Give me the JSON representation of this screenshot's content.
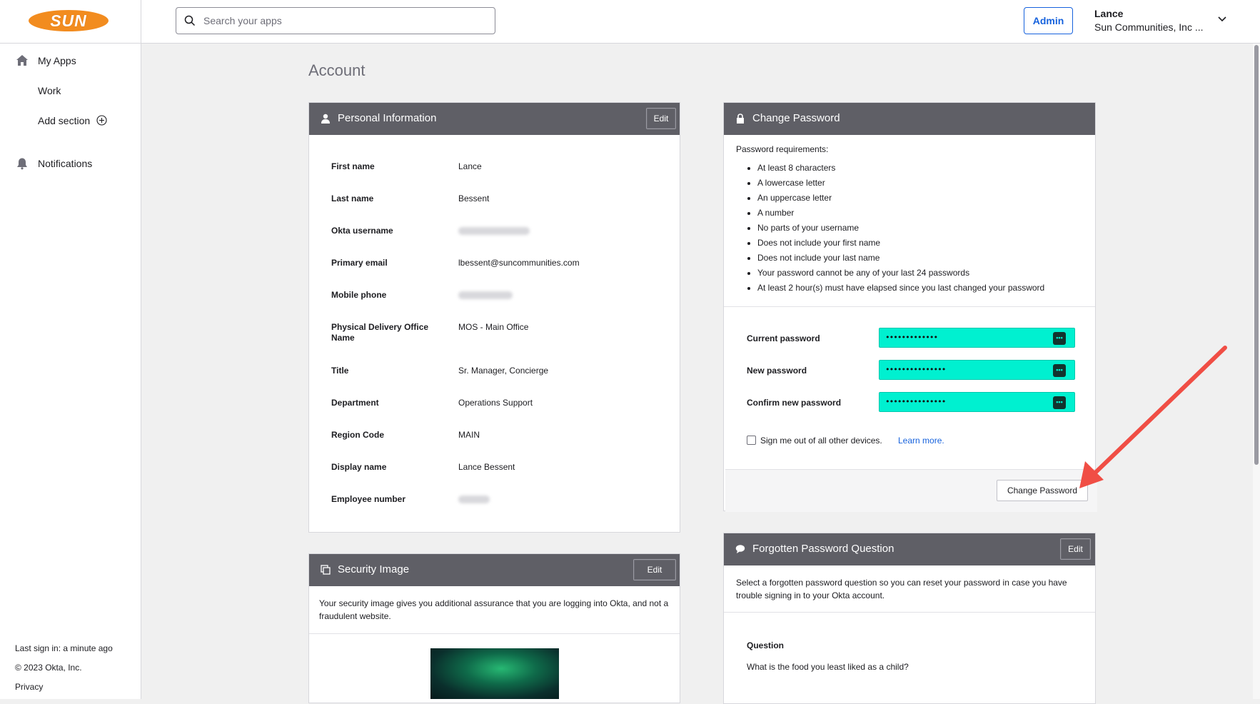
{
  "header": {
    "logo_text": "SUN",
    "search_placeholder": "Search your apps",
    "admin_label": "Admin",
    "user_name": "Lance",
    "user_org": "Sun Communities, Inc ..."
  },
  "sidebar": {
    "items": [
      {
        "label": "My Apps",
        "icon": "home-icon"
      },
      {
        "label": "Work"
      },
      {
        "label": "Add section",
        "icon": "add-circle-icon"
      },
      {
        "label": "Notifications",
        "icon": "bell-icon"
      }
    ],
    "last_sign_in": "Last sign in: a minute ago",
    "copyright": "© 2023 Okta, Inc.",
    "privacy": "Privacy"
  },
  "page": {
    "title": "Account"
  },
  "personal_info": {
    "title": "Personal Information",
    "edit_label": "Edit",
    "fields": [
      {
        "label": "First name",
        "value": "Lance"
      },
      {
        "label": "Last name",
        "value": "Bessent"
      },
      {
        "label": "Okta username",
        "value": ""
      },
      {
        "label": "Primary email",
        "value": "lbessent@suncommunities.com"
      },
      {
        "label": "Mobile phone",
        "value": ""
      },
      {
        "label": "Physical Delivery Office Name",
        "value": "MOS - Main Office"
      },
      {
        "label": "Title",
        "value": "Sr. Manager, Concierge"
      },
      {
        "label": "Department",
        "value": "Operations Support"
      },
      {
        "label": "Region Code",
        "value": "MAIN"
      },
      {
        "label": "Display name",
        "value": "Lance Bessent"
      },
      {
        "label": "Employee number",
        "value": ""
      }
    ]
  },
  "change_password": {
    "title": "Change Password",
    "requirements_title": "Password requirements:",
    "requirements": [
      "At least 8 characters",
      "A lowercase letter",
      "An uppercase letter",
      "A number",
      "No parts of your username",
      "Does not include your first name",
      "Does not include your last name",
      "Your password cannot be any of your last 24 passwords",
      "At least 2 hour(s) must have elapsed since you last changed your password"
    ],
    "current_label": "Current password",
    "current_value": "•••••••••••••",
    "new_label": "New password",
    "new_value": "•••••••••••••••",
    "confirm_label": "Confirm new password",
    "confirm_value": "•••••••••••••••",
    "pm_glyph": "•••",
    "signout_label": "Sign me out of all other devices.",
    "learn_more": "Learn more.",
    "button_label": "Change Password"
  },
  "security_image": {
    "title": "Security Image",
    "edit_label": "Edit",
    "description": "Your security image gives you additional assurance that you are logging into Okta, and not a fraudulent website."
  },
  "forgotten_question": {
    "title": "Forgotten Password Question",
    "edit_label": "Edit",
    "description": "Select a forgotten password question so you can reset your password in case you have trouble signing in to your Okta account.",
    "question_label": "Question",
    "question_value": "What is the food you least liked as a child?"
  },
  "colors": {
    "header_bg": "#5f5f66",
    "accent": "#1662dd",
    "autofill": "#00f0d0",
    "annotation_arrow": "#f04e45",
    "brand": "#f28c1f"
  }
}
